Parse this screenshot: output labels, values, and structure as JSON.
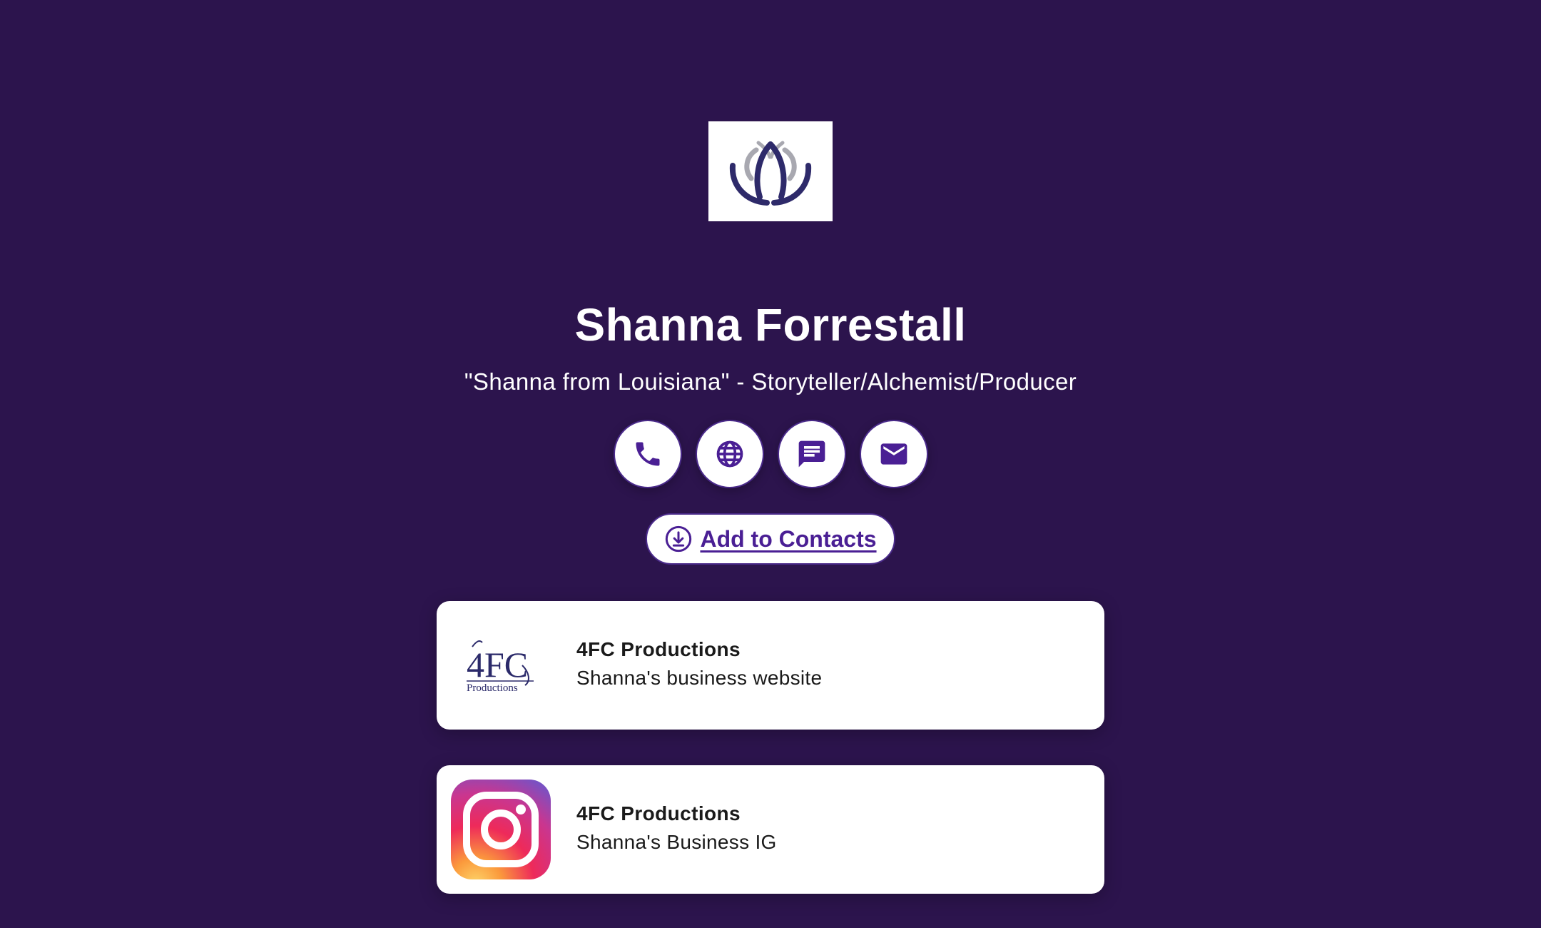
{
  "profile": {
    "name": "Shanna Forrestall",
    "tagline": "\"Shanna from Louisiana\" - Storyteller/Alchemist/Producer"
  },
  "actions": [
    {
      "icon": "phone-icon"
    },
    {
      "icon": "globe-icon"
    },
    {
      "icon": "message-icon"
    },
    {
      "icon": "email-icon"
    }
  ],
  "add_contacts": {
    "label": "Add to Contacts",
    "icon": "download-icon"
  },
  "links": [
    {
      "title": "4FC Productions",
      "subtitle": "Shanna's business website",
      "thumb": "4fc-productions-logo",
      "thumb_text": "4FC",
      "thumb_subtext": "Productions"
    },
    {
      "title": "4FC Productions",
      "subtitle": "Shanna's Business IG",
      "thumb": "instagram-icon"
    }
  ],
  "colors": {
    "background": "#2c144d",
    "accent": "#4a1f94",
    "card": "#ffffff"
  }
}
